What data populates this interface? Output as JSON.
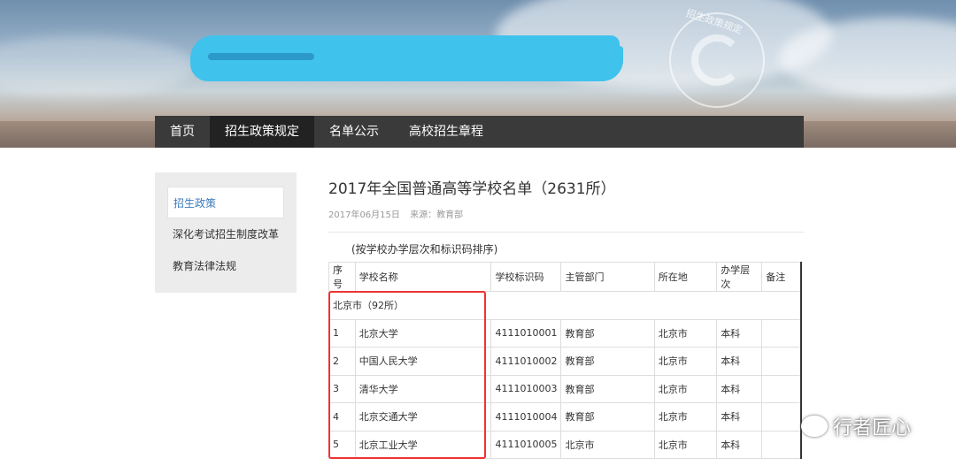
{
  "banner": {
    "seal_text": "招生政策规定"
  },
  "nav": {
    "items": [
      {
        "label": "首页"
      },
      {
        "label": "招生政策规定"
      },
      {
        "label": "名单公示"
      },
      {
        "label": "高校招生章程"
      }
    ]
  },
  "sidebar": {
    "items": [
      {
        "label": "招生政策"
      },
      {
        "label": "深化考试招生制度改革"
      },
      {
        "label": "教育法律法规"
      }
    ]
  },
  "article": {
    "title": "2017年全国普通高等学校名单（2631所）",
    "date": "2017年06月15日",
    "source": "来源：教育部",
    "note": "(按学校办学层次和标识码排序)"
  },
  "table": {
    "headers": [
      "序号",
      "学校名称",
      "学校标识码",
      "主管部门",
      "所在地",
      "办学层次",
      "备注"
    ],
    "group_label": "北京市（92所）",
    "rows": [
      {
        "no": "1",
        "name": "北京大学",
        "code": "4111010001",
        "dept": "教育部",
        "loc": "北京市",
        "level": "本科",
        "remark": ""
      },
      {
        "no": "2",
        "name": "中国人民大学",
        "code": "4111010002",
        "dept": "教育部",
        "loc": "北京市",
        "level": "本科",
        "remark": ""
      },
      {
        "no": "3",
        "name": "清华大学",
        "code": "4111010003",
        "dept": "教育部",
        "loc": "北京市",
        "level": "本科",
        "remark": ""
      },
      {
        "no": "4",
        "name": "北京交通大学",
        "code": "4111010004",
        "dept": "教育部",
        "loc": "北京市",
        "level": "本科",
        "remark": ""
      },
      {
        "no": "5",
        "name": "北京工业大学",
        "code": "4111010005",
        "dept": "北京市",
        "loc": "北京市",
        "level": "本科",
        "remark": ""
      }
    ]
  },
  "watermark": {
    "text": "行者匠心",
    "icon": "wechat-icon"
  },
  "colors": {
    "nav_bg": "#3a3a3a",
    "nav_active_bg": "#222222",
    "link_blue": "#3a7bbd",
    "highlight_red": "#ee3333",
    "scribble_blue": "#3fc2ec"
  }
}
